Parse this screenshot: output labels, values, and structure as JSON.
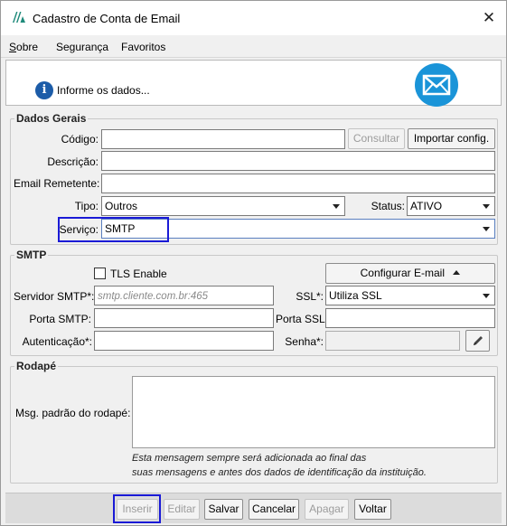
{
  "window": {
    "title": "Cadastro de Conta de Email",
    "close_glyph": "✕"
  },
  "menu": [
    {
      "mnemonic": "S",
      "rest": "obre"
    },
    {
      "mnemonic": "",
      "rest": "Segurança"
    },
    {
      "mnemonic": "",
      "rest": "Favoritos"
    }
  ],
  "info": {
    "icon_glyph": "i",
    "text": "Informe os dados..."
  },
  "dados_gerais": {
    "legend": "Dados Gerais",
    "codigo_label": "Código:",
    "codigo_value": "",
    "consultar_label": "Consultar",
    "importar_label": "Importar config.",
    "descricao_label": "Descrição:",
    "descricao_value": "",
    "email_remetente_label": "Email Remetente:",
    "email_remetente_value": "",
    "tipo_label": "Tipo:",
    "tipo_value": "Outros",
    "status_label": "Status:",
    "status_value": "ATIVO",
    "servico_label": "Serviço:",
    "servico_value": "SMTP"
  },
  "smtp": {
    "legend": "SMTP",
    "tls_label": "TLS Enable",
    "tls_checked": false,
    "configurar_label": "Configurar E-mail",
    "servidor_label": "Servidor SMTP*:",
    "servidor_placeholder": "smtp.cliente.com.br:465",
    "ssl_label": "SSL*:",
    "ssl_value": "Utiliza SSL",
    "porta_smtp_label": "Porta SMTP:",
    "porta_smtp_value": "",
    "porta_ssl_label": "Porta SSL:",
    "porta_ssl_value": "",
    "autenticacao_label": "Autenticação*:",
    "autenticacao_value": "",
    "senha_label": "Senha*:",
    "senha_value": ""
  },
  "rodape": {
    "legend": "Rodapé",
    "msg_label": "Msg. padrão do rodapé:",
    "msg_value": "",
    "hint_line1": "Esta mensagem sempre será adicionada ao final das",
    "hint_line2": "suas mensagens e antes dos dados de identificação da instituição."
  },
  "actions": {
    "inserir": "Inserir",
    "editar": "Editar",
    "salvar": "Salvar",
    "cancelar": "Cancelar",
    "apagar": "Apagar",
    "voltar": "Voltar"
  },
  "colors": {
    "highlight": "#1a1ad6",
    "mail_icon": "#1a94d8",
    "info_icon": "#1c5ca8",
    "logo": "#1e8a7a"
  }
}
